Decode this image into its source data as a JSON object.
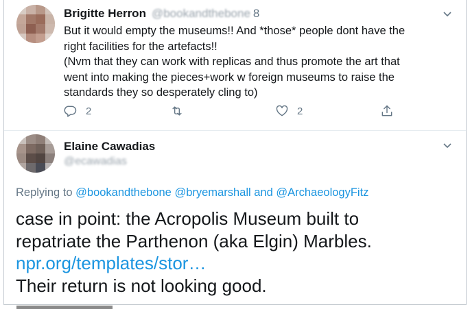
{
  "tweet1": {
    "author_name": "Brigitte Herron",
    "author_handle": "@bookandthebone",
    "date": "8",
    "text_lines": [
      "But it would empty the museums!! And *those* people dont have the",
      "right facilities for the artefacts!!",
      "(Nvm that they can work with replicas and thus promote the art that",
      "went into making the pieces+work w foreign museums to raise the",
      "standards they so desperately cling to)"
    ],
    "reply_count": "2",
    "like_count": "2",
    "icons": [
      "reply-icon",
      "retweet-icon",
      "like-icon",
      "share-icon",
      "chevron-down-icon"
    ]
  },
  "tweet2": {
    "author_name": "Elaine Cawadias",
    "author_handle": "@ecawadias",
    "replying_prefix": "Replying to",
    "reply_mentions": [
      "@bookandthebone",
      "@bryemarshall",
      "and",
      "@ArchaeologyFitz"
    ],
    "text_line1": "case in point: the Acropolis Museum built to",
    "text_line2": "repatriate the Parthenon (aka Elgin) Marbles.",
    "link": "npr.org/templates/stor…",
    "text_line3": "Their return is not looking good."
  },
  "colors": {
    "link": "#1b95e0",
    "muted": "#657786",
    "text": "#14171a",
    "border": "#c6ccd2"
  }
}
